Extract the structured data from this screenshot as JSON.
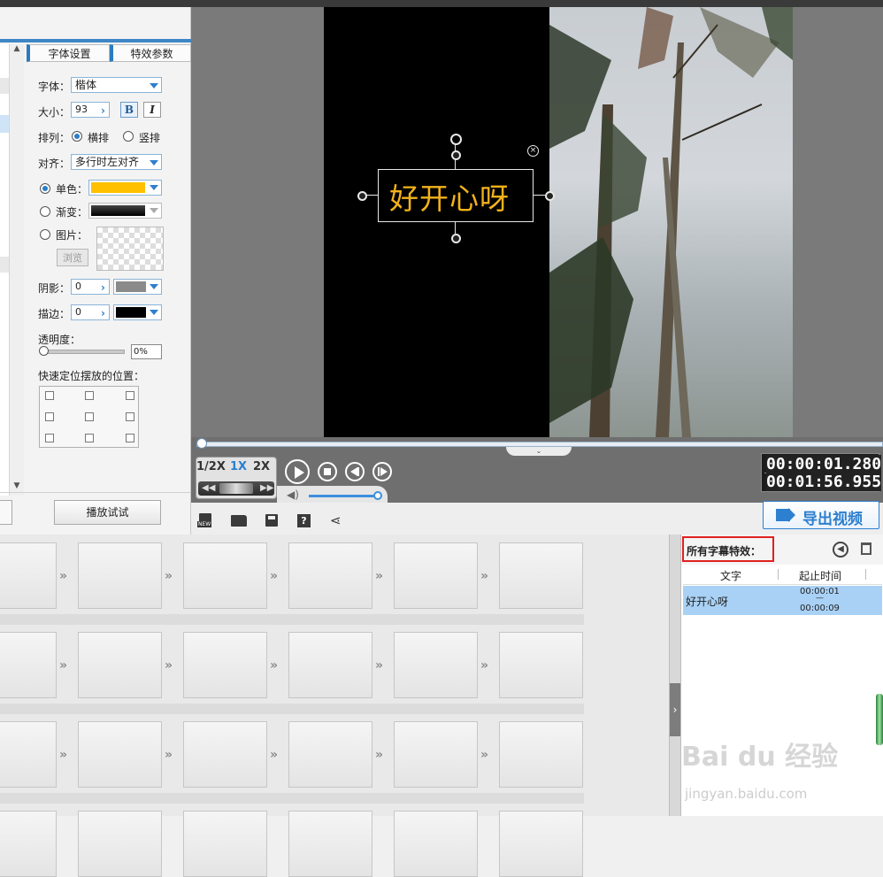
{
  "style_tabs": {
    "font_settings": "字体设置",
    "effect_params": "特效参数"
  },
  "font": {
    "label": "字体：",
    "value": "楷体"
  },
  "size": {
    "label": "大小：",
    "value": "93",
    "bold": "B",
    "italic": "I"
  },
  "layout": {
    "label": "排列：",
    "horizontal": "横排",
    "vertical": "竖排"
  },
  "align": {
    "label": "对齐：",
    "value": "多行时左对齐"
  },
  "color": {
    "solid_label": "单色：",
    "solid_value": "#ffc000",
    "gradient_label": "渐变：",
    "image_label": "图片：",
    "browse": "浏览"
  },
  "shadow": {
    "label": "阴影：",
    "value": "0",
    "color": "#8a8a8a"
  },
  "stroke": {
    "label": "描边：",
    "value": "0",
    "color": "#000000"
  },
  "opacity": {
    "label": "透明度：",
    "value": "0%"
  },
  "position": {
    "label": "快速定位摆放的位置："
  },
  "play_test": "播放试试",
  "preview": {
    "subtitle_text": "好开心呀",
    "subtitle_color": "#f2b21b"
  },
  "speed": {
    "half": "1/2X",
    "normal": "1X",
    "double": "2X"
  },
  "time": {
    "current": "00:00:01.280",
    "total": "00:01:56.955"
  },
  "export_label": "导出视频",
  "subtitles_panel": {
    "title": "所有字幕特效：",
    "columns": [
      "文字",
      "起止时间"
    ],
    "rows": [
      {
        "text": "好开心呀",
        "start": "00:00:01",
        "dash": "—",
        "end": "00:00:09"
      }
    ]
  },
  "watermark": {
    "brand": "Bai du 经验",
    "url": "jingyan.baidu.com"
  }
}
